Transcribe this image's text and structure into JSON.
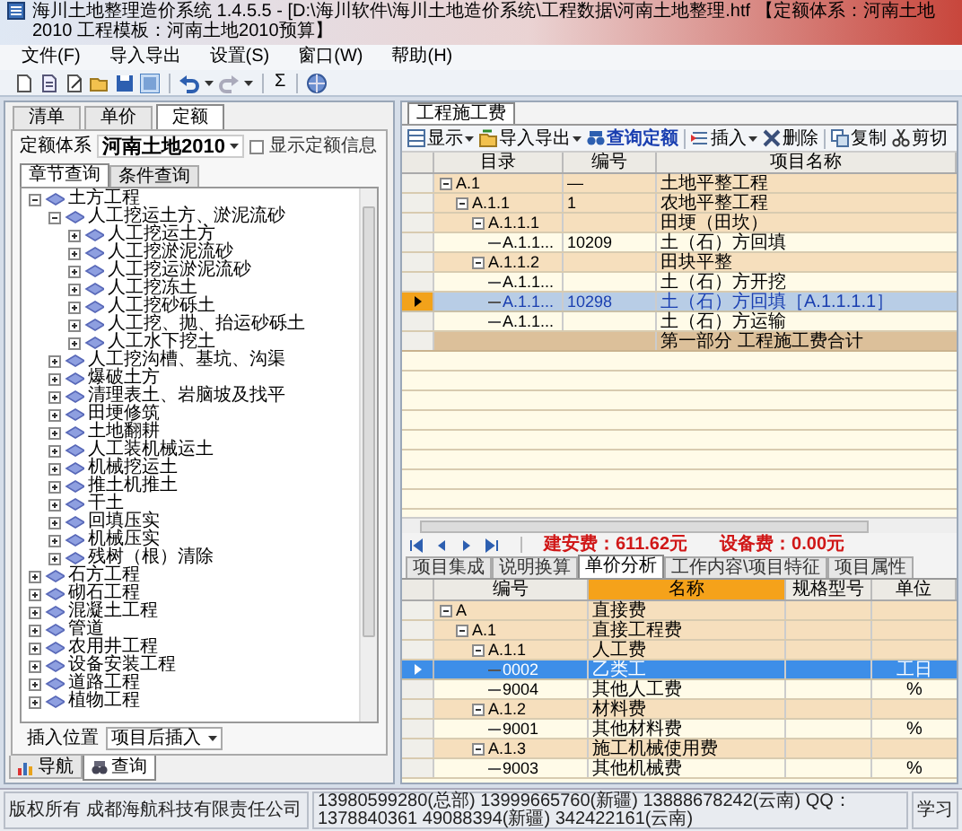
{
  "window": {
    "title": "海川土地整理造价系统 1.4.5.5 - [D:\\海川软件\\海川土地造价系统\\工程数据\\河南土地整理.htf 【定额体系：河南土地2010  工程模板：河南土地2010预算】"
  },
  "menu": [
    "文件(F)",
    "导入导出",
    "设置(S)",
    "窗口(W)",
    "帮助(H)"
  ],
  "toolbar": {
    "sum": "Σ"
  },
  "left_panel": {
    "tabs": [
      {
        "label": "清单",
        "selected": false
      },
      {
        "label": "单价",
        "selected": false
      },
      {
        "label": "定额",
        "selected": true
      }
    ],
    "quota_system": {
      "label": "定额体系",
      "value": "河南土地2010"
    },
    "show_info": {
      "label": "显示定额信息",
      "checked": false
    },
    "subtabs": [
      {
        "label": "章节查询",
        "selected": true
      },
      {
        "label": "条件查询",
        "selected": false
      }
    ],
    "tree": [
      {
        "label": "土方工程",
        "expanded": true,
        "children": [
          {
            "label": "人工挖运土方、淤泥流砂",
            "expanded": true,
            "children": [
              {
                "label": "人工挖运土方",
                "expanded": false
              },
              {
                "label": "人工挖淤泥流砂",
                "expanded": false
              },
              {
                "label": "人工挖运淤泥流砂",
                "expanded": false
              },
              {
                "label": "人工挖冻土",
                "expanded": false
              },
              {
                "label": "人工挖砂砾土",
                "expanded": false
              },
              {
                "label": "人工挖、抛、抬运砂砾土",
                "expanded": false
              },
              {
                "label": "人工水下挖土",
                "expanded": false
              }
            ]
          },
          {
            "label": "人工挖沟槽、基坑、沟渠",
            "expanded": false
          },
          {
            "label": "爆破土方",
            "expanded": false
          },
          {
            "label": "清理表土、岩脑坡及找平",
            "expanded": false
          },
          {
            "label": "田埂修筑",
            "expanded": false
          },
          {
            "label": "土地翻耕",
            "expanded": false
          },
          {
            "label": "人工装机械运土",
            "expanded": false
          },
          {
            "label": "机械挖运土",
            "expanded": false
          },
          {
            "label": "推土机推土",
            "expanded": false
          },
          {
            "label": "干土",
            "expanded": false
          },
          {
            "label": "回填压实",
            "expanded": false
          },
          {
            "label": "机械压实",
            "expanded": false
          },
          {
            "label": "残树（根）清除",
            "expanded": false
          }
        ]
      },
      {
        "label": "石方工程",
        "expanded": false
      },
      {
        "label": "砌石工程",
        "expanded": false
      },
      {
        "label": "混凝土工程",
        "expanded": false
      },
      {
        "label": "管道",
        "expanded": false
      },
      {
        "label": "农用井工程",
        "expanded": false
      },
      {
        "label": "设备安装工程",
        "expanded": false
      },
      {
        "label": "道路工程",
        "expanded": false
      },
      {
        "label": "植物工程",
        "expanded": false
      }
    ],
    "insert_position": {
      "label": "插入位置",
      "value": "项目后插入"
    },
    "bottom_tabs": [
      {
        "label": "导航",
        "selected": false
      },
      {
        "label": "查询",
        "selected": true
      }
    ]
  },
  "document_tabs": [
    {
      "label": "工程施工费",
      "selected": true
    }
  ],
  "grid_toolbar": [
    {
      "kind": "display",
      "label": "显示",
      "dropdown": true
    },
    {
      "kind": "import",
      "label": "导入导出",
      "dropdown": true
    },
    {
      "kind": "query",
      "label": "查询定额",
      "dropdown": false
    },
    {
      "kind": "insert",
      "label": "插入",
      "dropdown": true
    },
    {
      "kind": "delete",
      "label": "删除",
      "dropdown": false
    },
    {
      "kind": "copy",
      "label": "复制",
      "dropdown": false
    },
    {
      "kind": "cut",
      "label": "剪切",
      "dropdown": false
    }
  ],
  "grid": {
    "columns": [
      "目录",
      "编号",
      "项目名称"
    ],
    "rows": [
      {
        "code": "A.1",
        "number": "—",
        "name": "土地平整工程",
        "expanded": true,
        "selected": false,
        "children": [
          {
            "code": "A.1.1",
            "number": "1",
            "name": "农地平整工程",
            "expanded": true,
            "selected": false,
            "children": [
              {
                "code": "A.1.1.1",
                "name": "田埂（田坎）",
                "expanded": true,
                "selected": false,
                "children": [
                  {
                    "code": "A.1.1...",
                    "number": "10209",
                    "name": "土（石）方回填",
                    "selected": false
                  }
                ]
              },
              {
                "code": "A.1.1.2",
                "name": "田块平整",
                "expanded": true,
                "selected": false,
                "children": [
                  {
                    "code": "A.1.1...",
                    "name": "土（石）方开挖",
                    "selected": false
                  },
                  {
                    "code": "A.1.1...",
                    "number": "10298",
                    "name": "土（石）方回填［A.1.1.1.1］",
                    "selected": true
                  },
                  {
                    "code": "A.1.1...",
                    "name": "土（石）方运输",
                    "selected": false
                  }
                ]
              }
            ]
          }
        ]
      }
    ],
    "total_row": {
      "name": "第一部分 工程施工费合计"
    }
  },
  "totals": [
    "建安费：611.62元",
    "设备费：0.00元"
  ],
  "detail_tabs": [
    {
      "label": "项目集成",
      "selected": false
    },
    {
      "label": "说明换算",
      "selected": false
    },
    {
      "label": "单价分析",
      "selected": true
    },
    {
      "label": "工作内容\\项目特征",
      "selected": false
    },
    {
      "label": "项目属性",
      "selected": false
    }
  ],
  "detail_grid": {
    "columns": [
      {
        "label": "编号",
        "selected": false
      },
      {
        "label": "名称",
        "selected": true
      },
      {
        "label": "规格型号",
        "selected": false
      },
      {
        "label": "单位",
        "selected": false
      }
    ],
    "rows": [
      {
        "code": "A",
        "name": "直接费",
        "expanded": true,
        "selected": false,
        "children": [
          {
            "code": "A.1",
            "name": "直接工程费",
            "expanded": true,
            "selected": false,
            "children": [
              {
                "code": "A.1.1",
                "name": "人工费",
                "expanded": true,
                "selected": false,
                "children": [
                  {
                    "code": "0002",
                    "name": "乙类工",
                    "unit": "工日",
                    "selected": true
                  },
                  {
                    "code": "9004",
                    "name": "其他人工费",
                    "unit": "%",
                    "selected": false
                  }
                ]
              },
              {
                "code": "A.1.2",
                "name": "材料费",
                "expanded": true,
                "selected": false,
                "children": [
                  {
                    "code": "9001",
                    "name": "其他材料费",
                    "unit": "%",
                    "selected": false
                  }
                ]
              },
              {
                "code": "A.1.3",
                "name": "施工机械使用费",
                "expanded": true,
                "selected": false,
                "children": [
                  {
                    "code": "9003",
                    "name": "其他机械费",
                    "unit": "%",
                    "selected": false
                  }
                ]
              }
            ]
          }
        ]
      }
    ]
  },
  "status_bar": [
    "版权所有 成都海航科技有限责任公司",
    "13980599280(总部) 13999665760(新疆) 13888678242(云南) QQ：1378840361 49088394(新疆) 342422161(云南)",
    "学习"
  ]
}
